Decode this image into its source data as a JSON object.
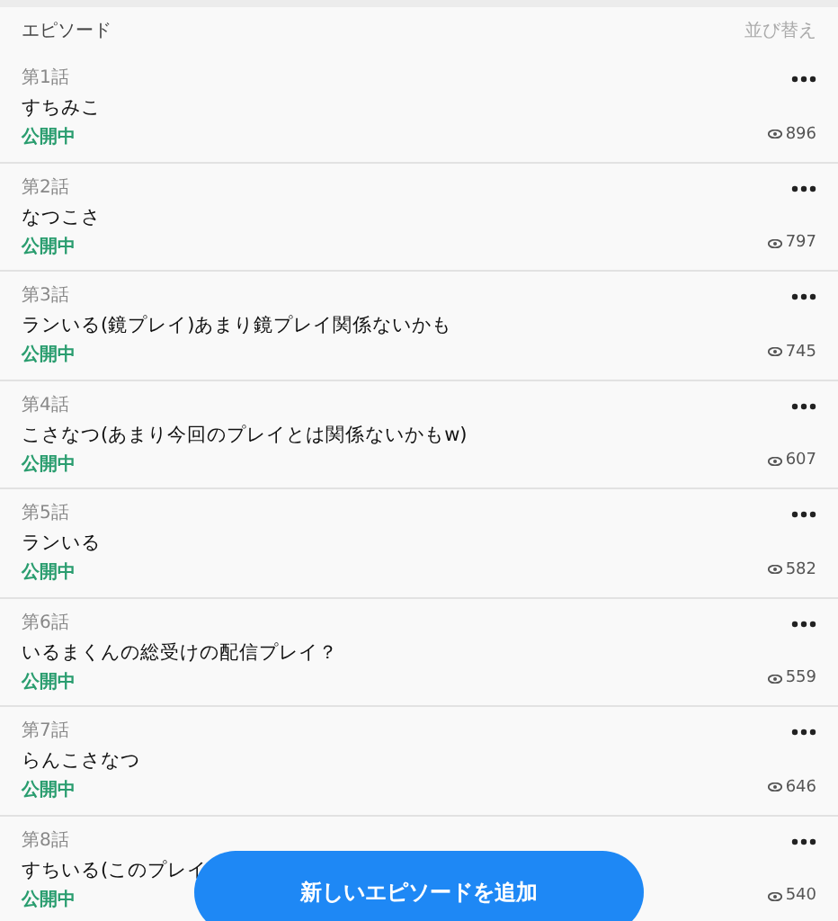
{
  "header": {
    "title": "エピソード",
    "sort": "並び替え"
  },
  "episodes": [
    {
      "number": "第1話",
      "title": "すちみこ",
      "status": "公開中",
      "views": "896"
    },
    {
      "number": "第2話",
      "title": "なつこさ",
      "status": "公開中",
      "views": "797"
    },
    {
      "number": "第3話",
      "title": "ランいる(鏡プレイ)あまり鏡プレイ関係ないかも",
      "status": "公開中",
      "views": "745"
    },
    {
      "number": "第4話",
      "title": "こさなつ(あまり今回のプレイとは関係ないかもw)",
      "status": "公開中",
      "views": "607"
    },
    {
      "number": "第5話",
      "title": "ランいる",
      "status": "公開中",
      "views": "582"
    },
    {
      "number": "第6話",
      "title": "いるまくんの総受けの配信プレイ？",
      "status": "公開中",
      "views": "559"
    },
    {
      "number": "第7話",
      "title": "らんこさなつ",
      "status": "公開中",
      "views": "646"
    },
    {
      "number": "第8話",
      "title": "すちいる(このプレイ",
      "status": "公開中",
      "views": "540"
    }
  ],
  "add_button": "新しいエピソードを追加"
}
